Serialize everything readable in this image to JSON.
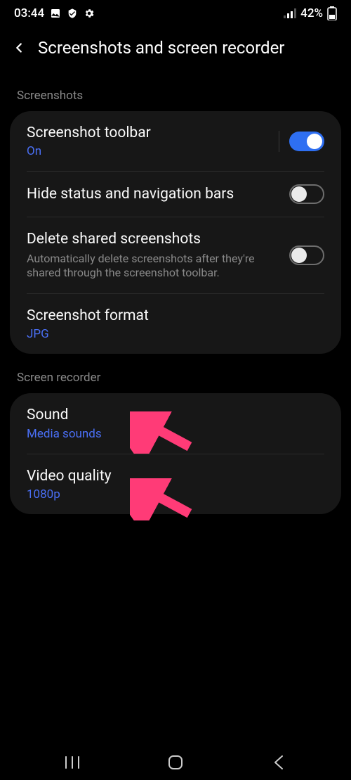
{
  "statusbar": {
    "time": "03:44",
    "battery": "42%"
  },
  "header": {
    "title": "Screenshots and screen recorder"
  },
  "sections": {
    "screenshots": {
      "header": "Screenshots",
      "toolbar": {
        "title": "Screenshot toolbar",
        "value": "On"
      },
      "hide_bars": {
        "title": "Hide status and navigation bars"
      },
      "delete_shared": {
        "title": "Delete shared screenshots",
        "desc": "Automatically delete screenshots after they're shared through the screenshot toolbar."
      },
      "format": {
        "title": "Screenshot format",
        "value": "JPG"
      }
    },
    "recorder": {
      "header": "Screen recorder",
      "sound": {
        "title": "Sound",
        "value": "Media sounds"
      },
      "video_quality": {
        "title": "Video quality",
        "value": "1080p"
      }
    }
  }
}
